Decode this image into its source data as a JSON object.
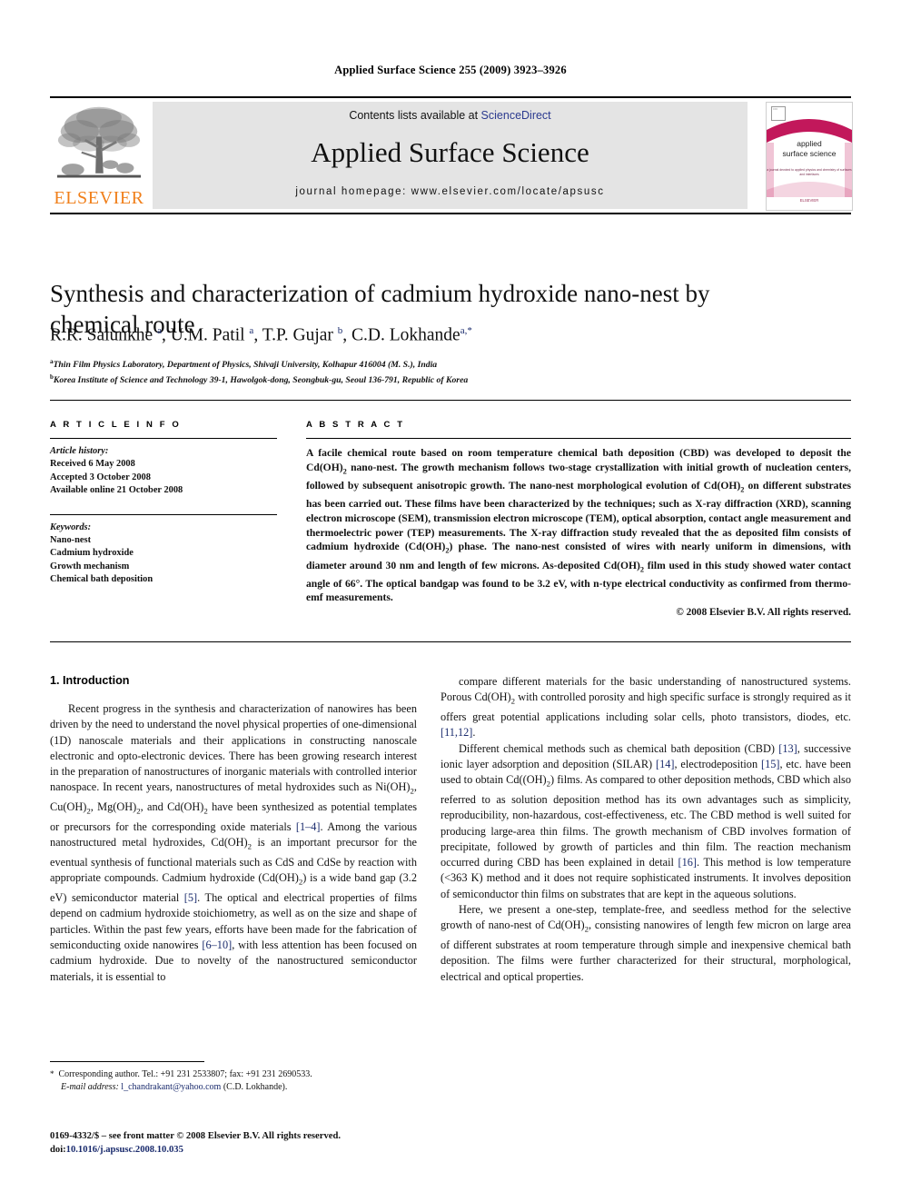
{
  "running_head": "Applied Surface Science 255 (2009) 3923–3926",
  "masthead": {
    "contents_prefix": "Contents lists available at ",
    "sciencedirect": "ScienceDirect",
    "journal_name": "Applied Surface Science",
    "homepage": "journal homepage: www.elsevier.com/locate/apsusc",
    "publisher_wordmark": "ELSEVIER",
    "cover": {
      "title_line1": "applied",
      "title_line2": "surface science",
      "subtitle": "a journal devoted to applied physics and chemistry of surfaces and interfaces",
      "brand": "ELSEVIER"
    },
    "accent_orange": "#F07F1A",
    "accent_magenta": "#c2185b",
    "link_blue": "#2b3a8f",
    "band_gray": "#e4e4e4"
  },
  "article": {
    "title": "Synthesis and characterization of cadmium hydroxide nano-nest by chemical route",
    "authors_html": "R.R. Salunkhe <sup>a</sup>, U.M. Patil <sup>a</sup>, T.P. Gujar <sup>b</sup>, C.D. Lokhande<sup>a,*</sup>",
    "affiliation_a": "Thin Film Physics Laboratory, Department of Physics, Shivaji University, Kolhapur 416004 (M. S.), India",
    "affiliation_b": "Korea Institute of Science and Technology 39-1, Hawolgok-dong, Seongbuk-gu, Seoul 136-791, Republic of Korea"
  },
  "info": {
    "heading": "A R T I C L E   I N F O",
    "history_label": "Article history:",
    "received": "Received 6 May 2008",
    "accepted": "Accepted 3 October 2008",
    "available": "Available online 21 October 2008",
    "keywords_label": "Keywords:",
    "keywords": [
      "Nano-nest",
      "Cadmium hydroxide",
      "Growth mechanism",
      "Chemical bath deposition"
    ]
  },
  "abstract": {
    "heading": "A B S T R A C T",
    "text_html": "A facile chemical route based on room temperature chemical bath deposition (CBD) was developed to deposit the Cd(OH)<sub>2</sub> nano-nest. The growth mechanism follows two-stage crystallization with initial growth of nucleation centers, followed by subsequent anisotropic growth. The nano-nest morphological evolution of Cd(OH)<sub>2</sub> on different substrates has been carried out. These films have been characterized by the techniques; such as X-ray diffraction (XRD), scanning electron microscope (SEM), transmission electron microscope (TEM), optical absorption, contact angle measurement and thermoelectric power (TEP) measurements. The X-ray diffraction study revealed that the as deposited film consists of cadmium hydroxide (Cd(OH)<sub>2</sub>) phase. The nano-nest consisted of wires with nearly uniform in dimensions, with diameter around 30 nm and length of few microns. As-deposited Cd(OH)<sub>2</sub> film used in this study showed water contact angle of 66°. The optical bandgap was found to be 3.2 eV, with n-type electrical conductivity as confirmed from thermo-emf measurements.",
    "copyright": "© 2008 Elsevier B.V. All rights reserved."
  },
  "body": {
    "section_heading": "1. Introduction",
    "left_paragraphs_html": [
      "Recent progress in the synthesis and characterization of nanowires has been driven by the need to understand the novel physical properties of one-dimensional (1D) nanoscale materials and their applications in constructing nanoscale electronic and opto-electronic devices. There has been growing research interest in the preparation of nanostructures of inorganic materials with controlled interior nanospace. In recent years, nanostructures of metal hydroxides such as Ni(OH)<sub>2</sub>, Cu(OH)<sub>2</sub>, Mg(OH)<sub>2</sub>, and Cd(OH)<sub>2</sub> have been synthesized as potential templates or precursors for the corresponding oxide materials <span class=\"ref\">[1–4]</span>. Among the various nanostructured metal hydroxides, Cd(OH)<sub>2</sub> is an important precursor for the eventual synthesis of functional materials such as CdS and CdSe by reaction with appropriate compounds. Cadmium hydroxide (Cd(OH)<sub>2</sub>) is a wide band gap (3.2 eV) semiconductor material <span class=\"ref\">[5]</span>. The optical and electrical properties of films depend on cadmium hydroxide stoichiometry, as well as on the size and shape of particles. Within the past few years, efforts have been made for the fabrication of semiconducting oxide nanowires <span class=\"ref\">[6–10]</span>, with less attention has been focused on cadmium hydroxide. Due to novelty of the nanostructured semiconductor materials, it is essential to"
    ],
    "right_paragraphs_html": [
      "compare different materials for the basic understanding of nanostructured systems. Porous Cd(OH)<sub>2</sub> with controlled porosity and high specific surface is strongly required as it offers great potential applications including solar cells, photo transistors, diodes, etc. <span class=\"ref\">[11,12]</span>.",
      "Different chemical methods such as chemical bath deposition (CBD) <span class=\"ref\">[13]</span>, successive ionic layer adsorption and deposition (SILAR) <span class=\"ref\">[14]</span>, electrodeposition <span class=\"ref\">[15]</span>, etc. have been used to obtain Cd((OH)<sub>2</sub>) films. As compared to other deposition methods, CBD which also referred to as solution deposition method has its own advantages such as simplicity, reproducibility, non-hazardous, cost-effectiveness, etc. The CBD method is well suited for producing large-area thin films. The growth mechanism of CBD involves formation of precipitate, followed by growth of particles and thin film. The reaction mechanism occurred during CBD has been explained in detail <span class=\"ref\">[16]</span>. This method is low temperature (&lt;363 K) method and it does not require sophisticated instruments. It involves deposition of semiconductor thin films on substrates that are kept in the aqueous solutions.",
      "Here, we present a one-step, template-free, and seedless method for the selective growth of nano-nest of Cd(OH)<sub>2</sub>, consisting nanowires of length few micron on large area of different substrates at room temperature through simple and inexpensive chemical bath deposition. The films were further characterized for their structural, morphological, electrical and optical properties."
    ]
  },
  "footer": {
    "corresponding_html": "<span class=\"ast\">*</span>&nbsp; Corresponding author. Tel.: +91 231 2533807; fax: +91 231 2690533.",
    "email_html": "<i>E-mail address:</i> <span class=\"mail\">l_chandrakant@yahoo.com</span> (C.D. Lokhande).",
    "imprint_html": "0169-4332/$ – see front matter © 2008 Elsevier B.V. All rights reserved.",
    "doi_html": "doi:<span class=\"doi\">10.1016/j.apsusc.2008.10.035</span>"
  }
}
